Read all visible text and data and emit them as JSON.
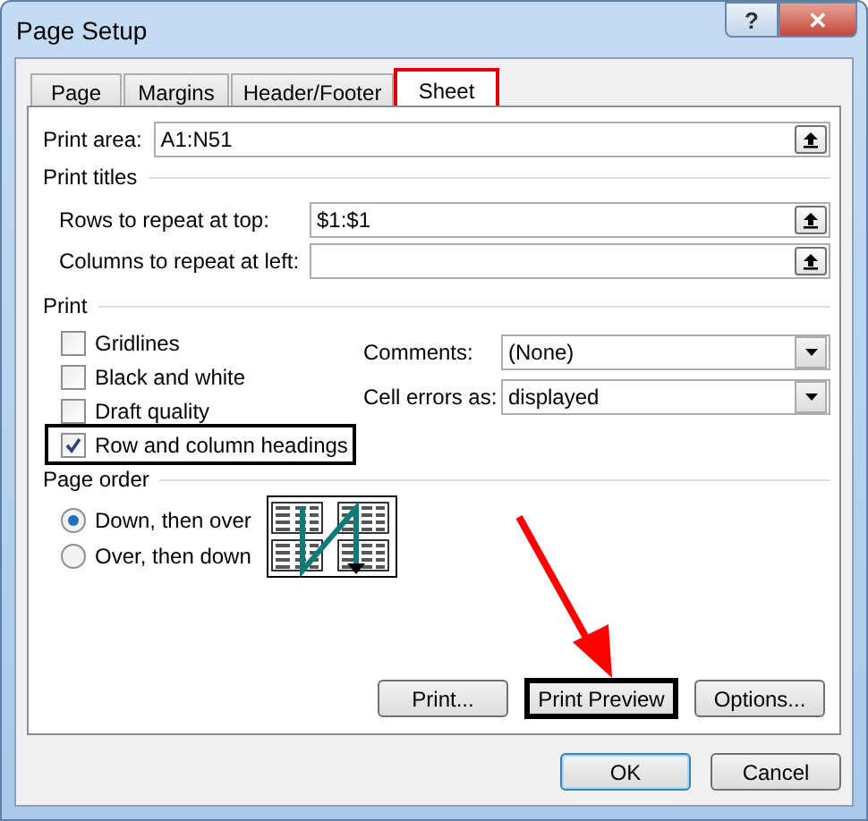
{
  "window": {
    "title": "Page Setup",
    "help_button": "?",
    "close_button": "✕"
  },
  "tabs": [
    {
      "label": "Page",
      "selected": false,
      "highlighted": false
    },
    {
      "label": "Margins",
      "selected": false,
      "highlighted": false
    },
    {
      "label": "Header/Footer",
      "selected": false,
      "highlighted": false
    },
    {
      "label": "Sheet",
      "selected": true,
      "highlighted": true
    }
  ],
  "print_area": {
    "label": "Print area:",
    "value": "A1:N51"
  },
  "print_titles": {
    "heading": "Print titles",
    "fields": [
      {
        "label": "Rows to repeat at top:",
        "value": "$1:$1"
      },
      {
        "label": "Columns to repeat at left:"
      }
    ]
  },
  "print": {
    "heading": "Print",
    "checkboxes": [
      {
        "label": "Gridlines",
        "checked": false,
        "highlighted": false
      },
      {
        "label": "Black and white",
        "checked": false,
        "highlighted": false
      },
      {
        "label": "Draft quality",
        "checked": false,
        "highlighted": false
      },
      {
        "label": "Row and column headings",
        "checked": true,
        "highlighted": true
      }
    ],
    "dropdowns": [
      {
        "label": "Comments:",
        "value": "(None)"
      },
      {
        "label": "Cell errors as:",
        "value": "displayed"
      }
    ]
  },
  "page_order": {
    "heading": "Page order",
    "options": [
      {
        "label": "Down, then over",
        "selected": true
      },
      {
        "label": "Over, then down",
        "selected": false
      }
    ]
  },
  "panel_buttons": [
    {
      "label": "Print...",
      "highlighted": false
    },
    {
      "label": "Print Preview",
      "highlighted": true
    },
    {
      "label": "Options...",
      "highlighted": false
    }
  ],
  "annotation_arrow": true,
  "dialog_buttons": [
    {
      "label": "OK",
      "default": true
    },
    {
      "label": "Cancel",
      "default": false
    }
  ]
}
